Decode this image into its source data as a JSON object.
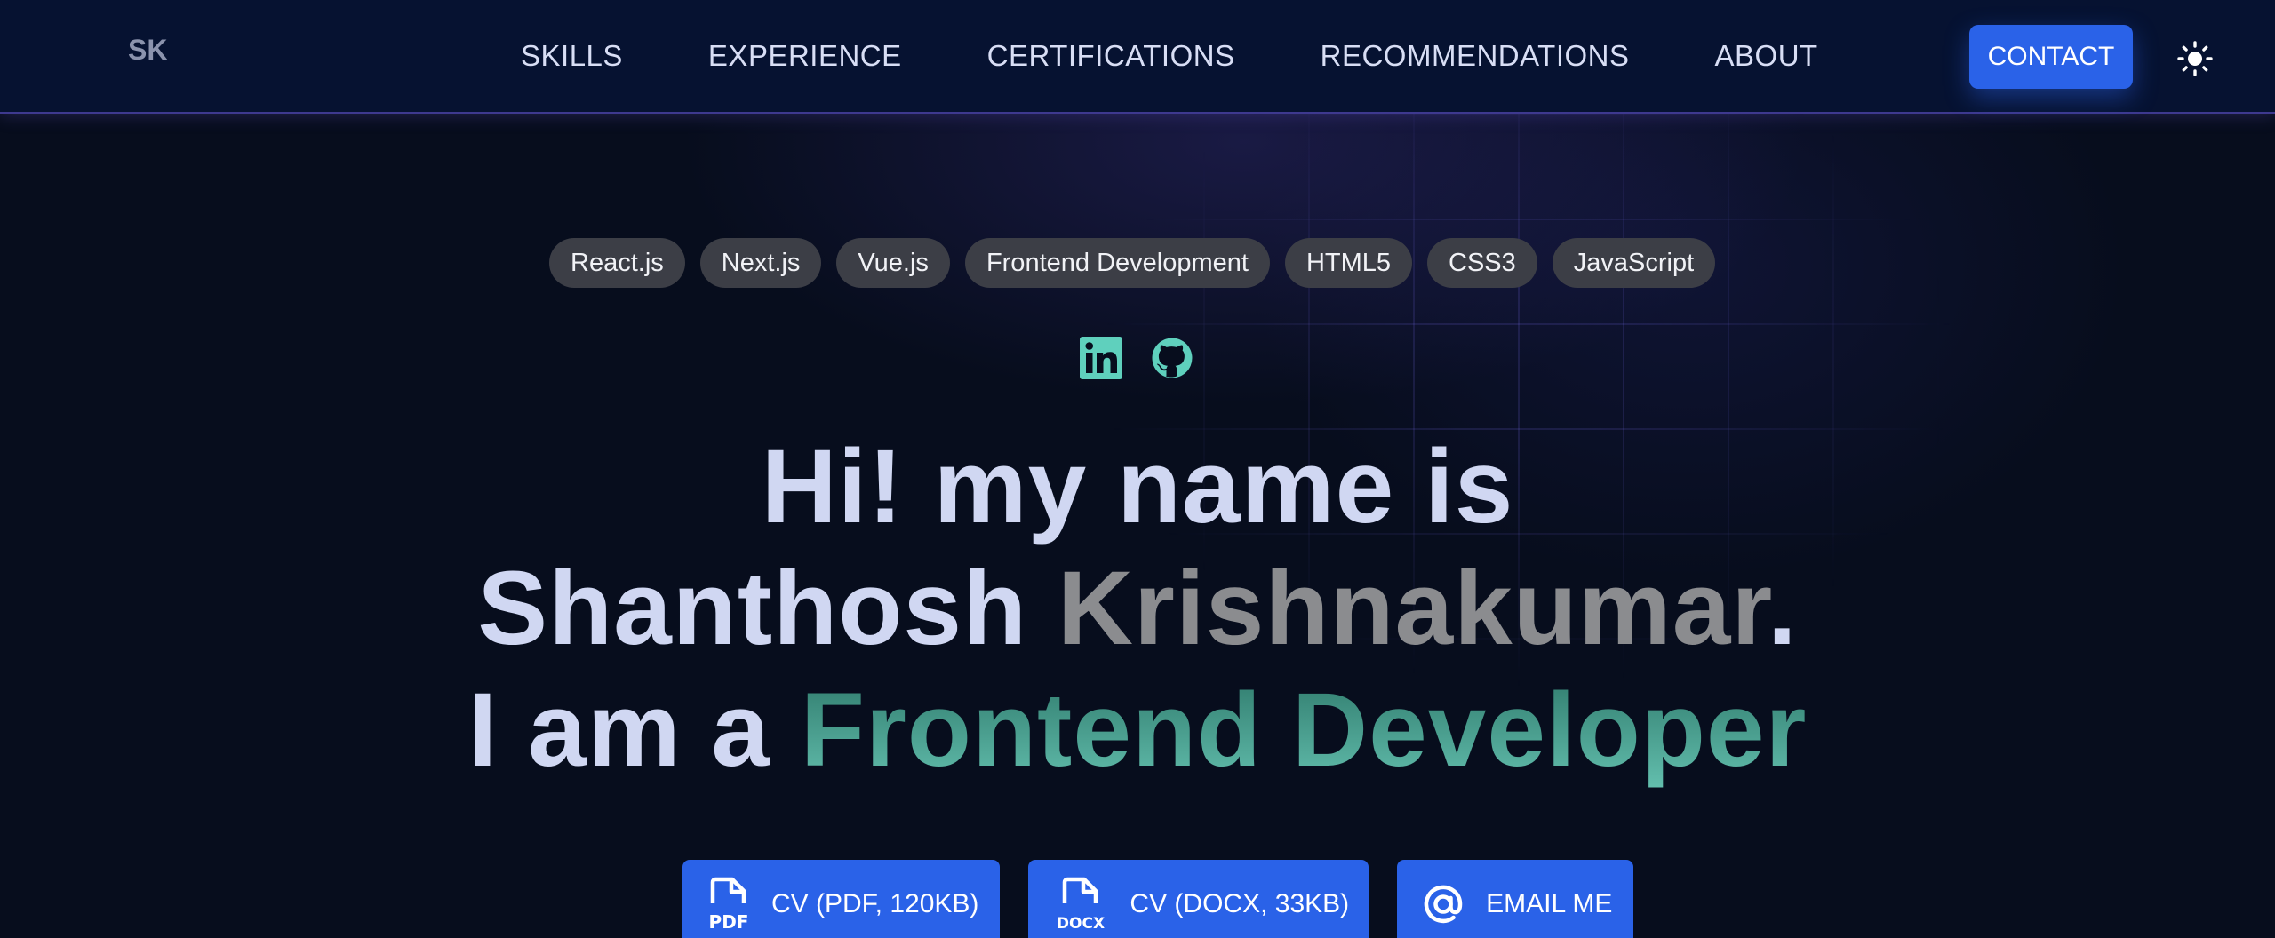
{
  "header": {
    "logo": "SK",
    "nav": [
      "SKILLS",
      "EXPERIENCE",
      "CERTIFICATIONS",
      "RECOMMENDATIONS",
      "ABOUT"
    ],
    "contact_label": "CONTACT",
    "theme_icon": "sun-icon"
  },
  "hero": {
    "tags": [
      "React.js",
      "Next.js",
      "Vue.js",
      "Frontend Development",
      "HTML5",
      "CSS3",
      "JavaScript"
    ],
    "social": [
      {
        "name": "linkedin",
        "icon": "linkedin-icon"
      },
      {
        "name": "github",
        "icon": "github-icon"
      }
    ],
    "line1": "Hi! my name is",
    "first_name": "Shanthosh",
    "last_name": "Krishnakumar",
    "period": ".",
    "line3_prefix": "I am a",
    "role": "Frontend Developer"
  },
  "actions": {
    "cv_pdf": {
      "icon_text": "PDF",
      "label": "CV (PDF, 120KB)"
    },
    "cv_docx": {
      "icon_text": "DOCX",
      "label": "CV (DOCX, 33KB)"
    },
    "email": {
      "label": "EMAIL ME"
    }
  },
  "colors": {
    "background": "#070d1d",
    "header_bg": "#061231",
    "accent_blue": "#2a62e8",
    "accent_teal": "#63bfae",
    "tag_bg": "#3c3e46"
  }
}
